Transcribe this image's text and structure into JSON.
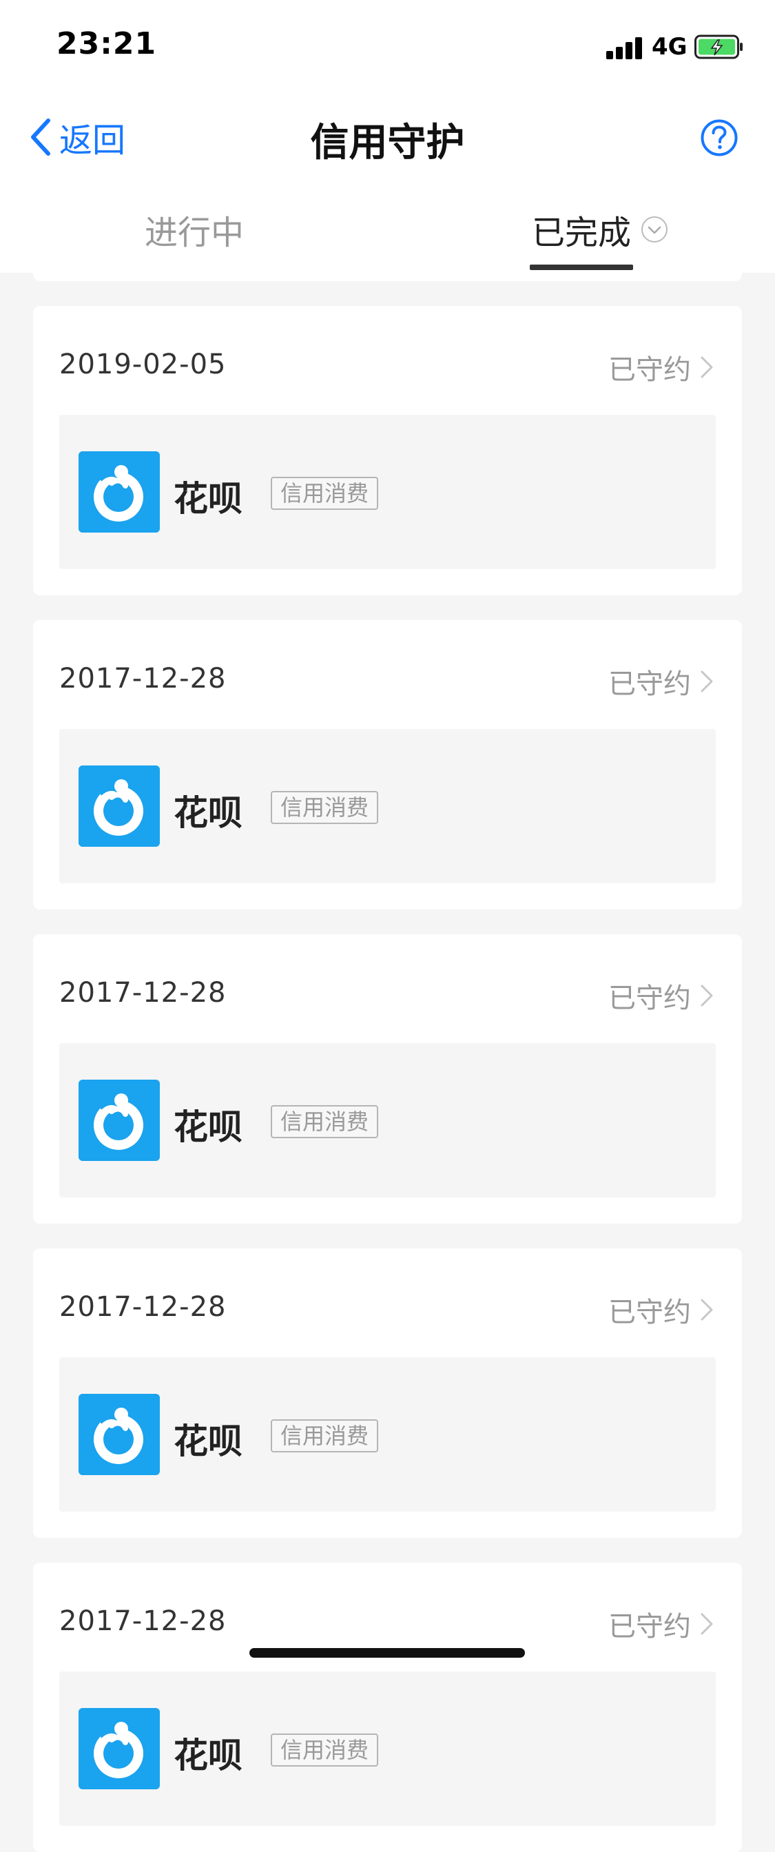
{
  "status_bar": {
    "time": "23:21",
    "network": "4G"
  },
  "nav": {
    "back_label": "返回",
    "title": "信用守护"
  },
  "tabs": [
    {
      "label": "进行中"
    },
    {
      "label": "已完成"
    }
  ],
  "records": [
    {
      "date": "2019-02-05",
      "status": "已守约",
      "product": "花呗",
      "tag": "信用消费"
    },
    {
      "date": "2017-12-28",
      "status": "已守约",
      "product": "花呗",
      "tag": "信用消费"
    },
    {
      "date": "2017-12-28",
      "status": "已守约",
      "product": "花呗",
      "tag": "信用消费"
    },
    {
      "date": "2017-12-28",
      "status": "已守约",
      "product": "花呗",
      "tag": "信用消费"
    },
    {
      "date": "2017-12-28",
      "status": "已守约",
      "product": "花呗",
      "tag": "信用消费"
    }
  ],
  "icons": {
    "back": "chevron-left-icon",
    "help": "question-circle-icon",
    "tab_dropdown": "chevron-down-circle-icon",
    "status_arrow": "chevron-right-icon",
    "product_logo": "huabei-logo-icon"
  },
  "colors": {
    "accent": "#1677ff",
    "logo_bg": "#1aa3ee",
    "page_bg": "#f5f5f5",
    "battery_fill": "#4cd964"
  }
}
